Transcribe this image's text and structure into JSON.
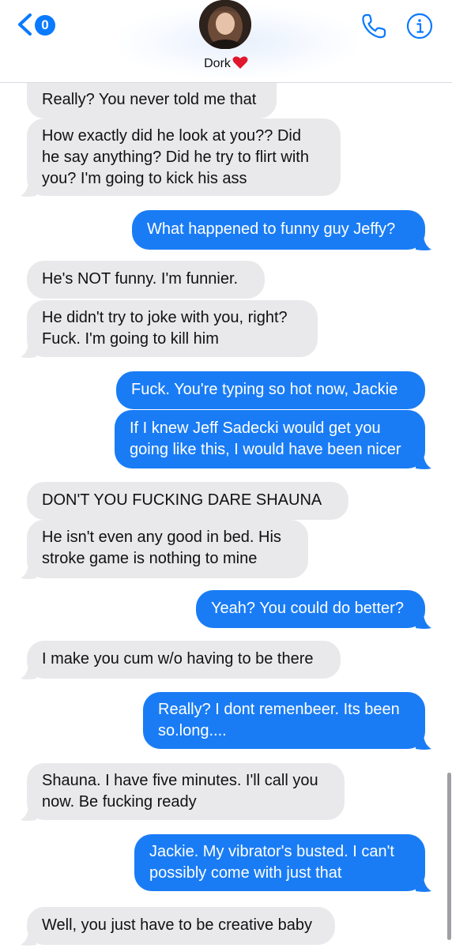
{
  "header": {
    "back_badge": "0",
    "contact_name": "Dork",
    "icons": {
      "back": "chevron-left-icon",
      "phone": "phone-icon",
      "info": "info-icon",
      "heart": "heart-emoji"
    },
    "accent_color": "#0a7aff"
  },
  "messages": [
    {
      "dir": "received",
      "text": "Really? You never told me that"
    },
    {
      "dir": "received",
      "text": "How exactly did he look at you?? Did\nhe say anything? Did he try to flirt with\nyou? I'm going to kick his ass"
    },
    {
      "dir": "sent",
      "text": "What happened to funny guy Jeffy?"
    },
    {
      "dir": "received",
      "text": "He's NOT funny. I'm funnier."
    },
    {
      "dir": "received",
      "text": "He didn't try to joke with you, right?\nFuck. I'm going to kill him"
    },
    {
      "dir": "sent",
      "text": "Fuck. You're typing so hot now, Jackie"
    },
    {
      "dir": "sent",
      "text": "If I knew Jeff Sadecki would get you\ngoing like this, I would have been nicer"
    },
    {
      "dir": "received",
      "text": "DON'T YOU FUCKING DARE SHAUNA"
    },
    {
      "dir": "received",
      "text": "He isn't even any good in bed. His\nstroke game is nothing to mine"
    },
    {
      "dir": "sent",
      "text": "Yeah? You could do better?"
    },
    {
      "dir": "received",
      "text": "I make you cum w/o having to be there"
    },
    {
      "dir": "sent",
      "text": "Really? I dont remenbeer. Its been\nso.long...."
    },
    {
      "dir": "received",
      "text": "Shauna. I have five minutes. I'll call you\nnow. Be fucking ready"
    },
    {
      "dir": "sent",
      "text": "Jackie. My vibrator's busted. I can't\npossibly come with just that"
    },
    {
      "dir": "received",
      "text": "Well, you just have to be creative baby"
    }
  ],
  "colors": {
    "received_bubble": "#e9e9eb",
    "sent_bubble": "#1a7cf5",
    "received_text": "#111111",
    "sent_text": "#ffffff"
  }
}
